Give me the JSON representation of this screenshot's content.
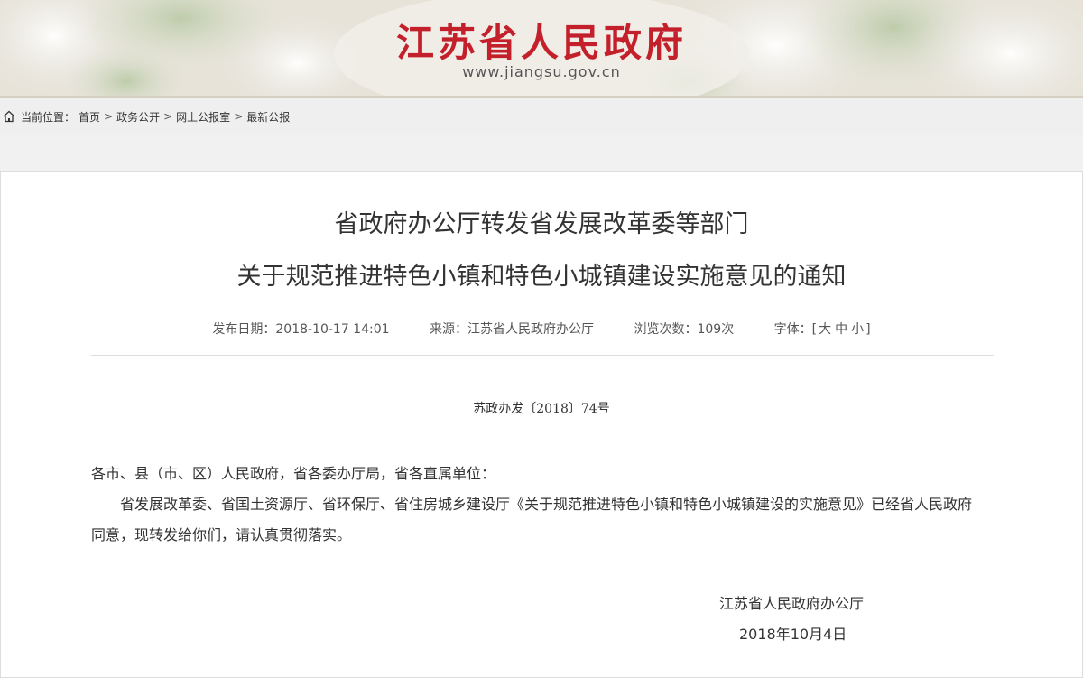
{
  "header": {
    "site_title": "江苏省人民政府",
    "site_url": "www.jiangsu.gov.cn",
    "title_color": "#c3202b"
  },
  "breadcrumb": {
    "icon": "home-icon",
    "label": "当前位置：",
    "items": [
      "首页",
      "政务公开",
      "网上公报室",
      "最新公报"
    ],
    "separator": ">"
  },
  "article": {
    "title_line1": "省政府办公厅转发省发展改革委等部门",
    "title_line2": "关于规范推进特色小镇和特色小城镇建设实施意见的通知",
    "meta": {
      "publish_date": "发布日期：2018-10-17 14:01",
      "source": "来源：江苏省人民政府办公厅",
      "views": "浏览次数：109次",
      "font_label": "字体：[",
      "font_large": "大",
      "font_medium": "中",
      "font_small": "小",
      "font_close": "]"
    },
    "doc_number": "苏政办发〔2018〕74号",
    "salutation": "各市、县（市、区）人民政府，省各委办厅局，省各直属单位：",
    "paragraph": "省发展改革委、省国土资源厅、省环保厅、省住房城乡建设厅《关于规范推进特色小镇和特色小城镇建设的实施意见》已经省人民政府同意，现转发给你们，请认真贯彻落实。",
    "signer": "江苏省人民政府办公厅",
    "sign_date": "2018年10月4日"
  }
}
